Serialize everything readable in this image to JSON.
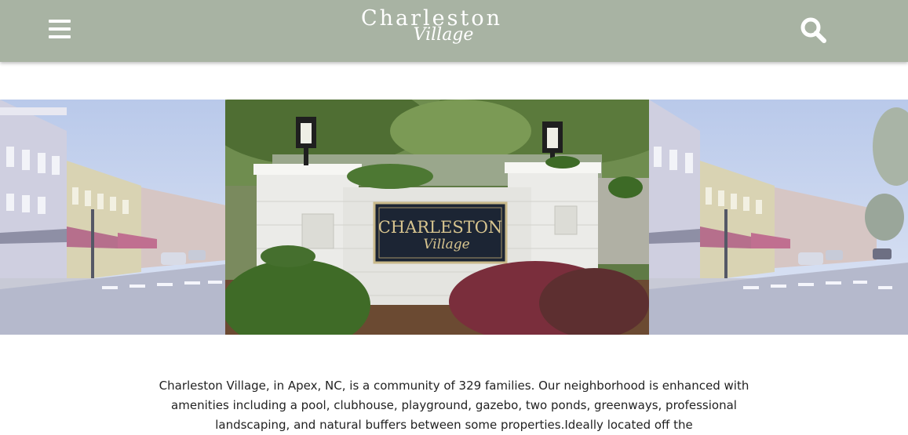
{
  "header": {
    "logo_main": "Charleston",
    "logo_sub": "Village",
    "menu_icon": "hamburger-menu-icon",
    "search_icon": "search-icon",
    "bar_color": "#a8b3a3"
  },
  "hero": {
    "sign_line1": "CHARLESTON",
    "sign_line2": "Village"
  },
  "intro": {
    "text": "Charleston Village, in Apex, NC, is a community of 329 families. Our neighborhood is enhanced with amenities including a pool, clubhouse, playground, gazebo, two ponds, greenways, professional landscaping, and natural buffers between some properties.Ideally located off the"
  }
}
